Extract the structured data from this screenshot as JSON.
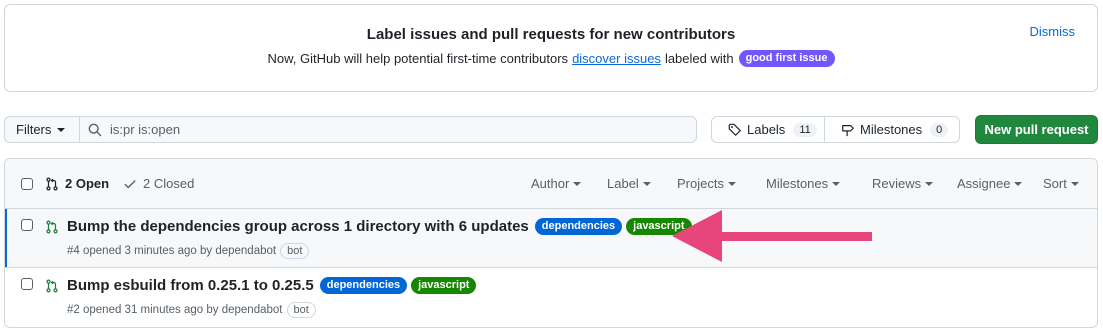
{
  "banner": {
    "title": "Label issues and pull requests for new contributors",
    "desc_prefix": "Now, GitHub will help potential first-time contributors",
    "desc_link": "discover issues",
    "desc_suffix": "labeled with",
    "label": "good first issue",
    "label_color": "#7057ff",
    "dismiss": "Dismiss"
  },
  "toolbar": {
    "filters": "Filters",
    "search_value": "is:pr is:open",
    "labels": "Labels",
    "labels_count": "11",
    "milestones": "Milestones",
    "milestones_count": "0",
    "new_pr": "New pull request",
    "new_pr_color": "#1f883d"
  },
  "list_header": {
    "open": "2 Open",
    "closed": "2 Closed",
    "menus": [
      "Author",
      "Label",
      "Projects",
      "Milestones",
      "Reviews",
      "Assignee",
      "Sort"
    ]
  },
  "pull_requests": [
    {
      "title": "Bump the dependencies group across 1 directory with 6 updates",
      "labels": [
        "dependencies",
        "javascript"
      ],
      "meta": "#4 opened 3 minutes ago by dependabot",
      "badge": "bot"
    },
    {
      "title": "Bump esbuild from 0.25.1 to 0.25.5",
      "labels": [
        "dependencies",
        "javascript"
      ],
      "meta": "#2 opened 31 minutes ago by dependabot",
      "badge": "bot"
    }
  ],
  "colors": {
    "dependencies": "#0366d6",
    "javascript": "#168700",
    "annotation_arrow": "#e8457c"
  }
}
